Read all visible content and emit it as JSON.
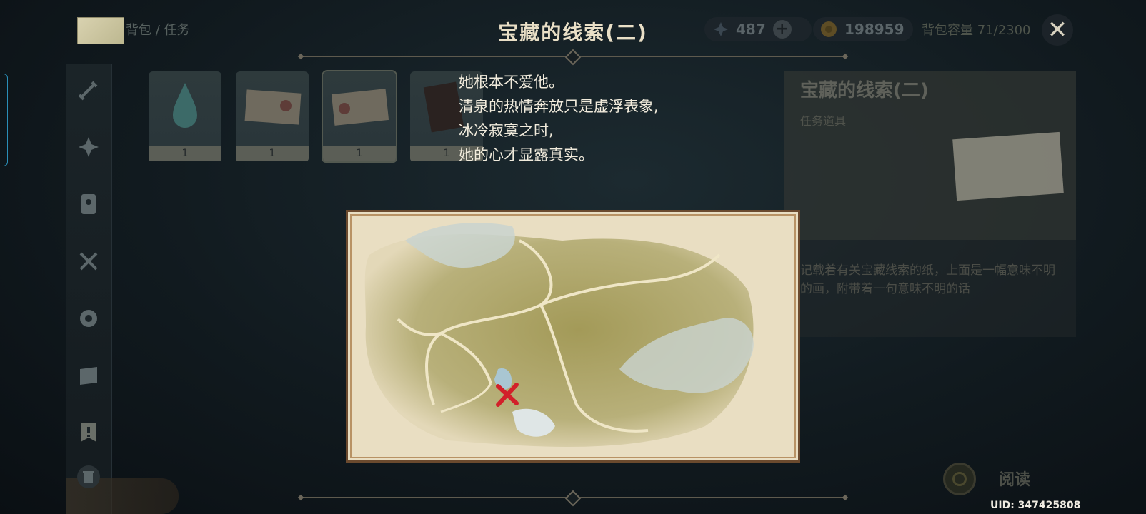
{
  "header": {
    "breadcrumb": "背包 / 任务",
    "title": "宝藏的线索(二)",
    "currency_primo": "487",
    "currency_mora": "198959",
    "capacity": "背包容量 71/2300"
  },
  "items": [
    {
      "icon": "water-drop-icon",
      "count": "1"
    },
    {
      "icon": "paper-note-icon",
      "count": "1"
    },
    {
      "icon": "paper-note-icon",
      "count": "1"
    },
    {
      "icon": "book-icon",
      "count": "1"
    }
  ],
  "clue_text": [
    "她根本不爱他。",
    "清泉的热情奔放只是虚浮表象,",
    "冰冷寂寞之时,",
    "她的心才显露真实。"
  ],
  "detail": {
    "name": "宝藏的线索(二)",
    "type": "任务道具",
    "description": "记载着有关宝藏线索的纸，上面是一幅意味不明的画，附带着一句意味不明的话"
  },
  "actions": {
    "read": "阅读"
  },
  "uid": "UID: 347425808",
  "colors": {
    "accent": "#e9dfc6",
    "map_mark": "#d2202a"
  }
}
